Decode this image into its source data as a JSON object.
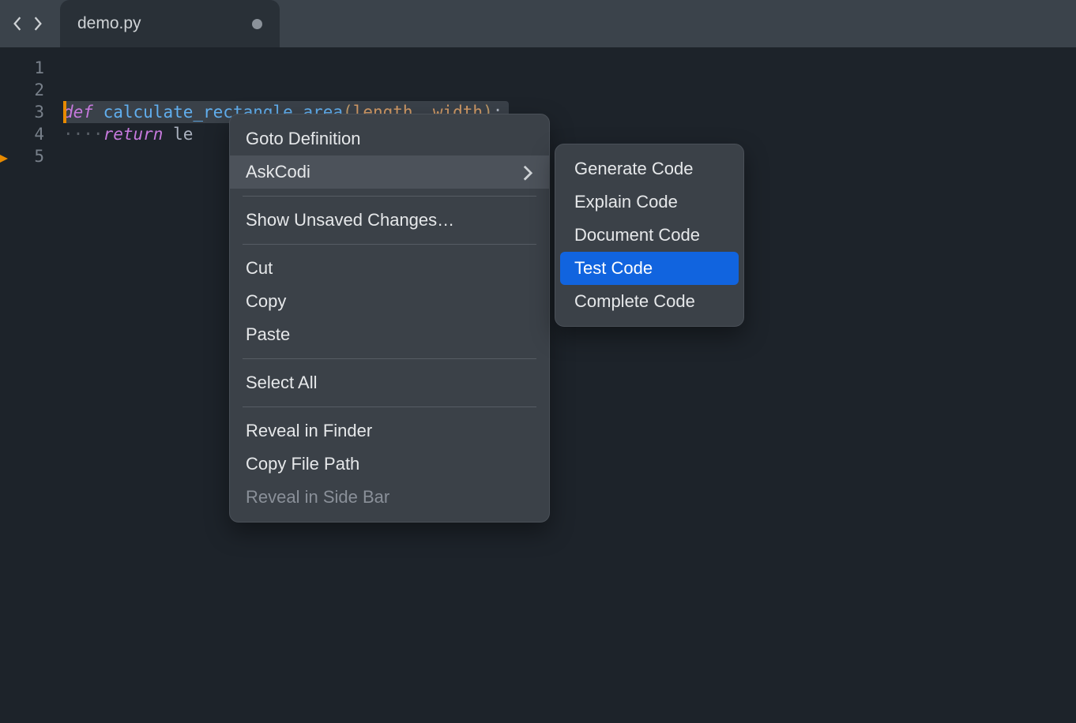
{
  "tab": {
    "filename": "demo.py"
  },
  "gutter": {
    "lines": [
      "1",
      "2",
      "3",
      "4",
      "5"
    ]
  },
  "code": {
    "def": "def",
    "space1": " ",
    "fn": "calculate_rectangle_area",
    "lparen": "(",
    "p1": "length",
    "comma": ", ",
    "p2": "width",
    "rparen": ")",
    "colon": ":",
    "indent": "····",
    "ret": "return",
    "retspace": " ",
    "rest": "le"
  },
  "context_menu": {
    "goto_def": "Goto Definition",
    "askcodi": "AskCodi",
    "show_unsaved": "Show Unsaved Changes…",
    "cut": "Cut",
    "copy": "Copy",
    "paste": "Paste",
    "select_all": "Select All",
    "reveal_finder": "Reveal in Finder",
    "copy_path": "Copy File Path",
    "reveal_sidebar": "Reveal in Side Bar"
  },
  "submenu": {
    "generate": "Generate Code",
    "explain": "Explain Code",
    "document": "Document Code",
    "test": "Test Code",
    "complete": "Complete Code"
  },
  "colors": {
    "accent": "#1164df",
    "orange": "#e78a00"
  }
}
